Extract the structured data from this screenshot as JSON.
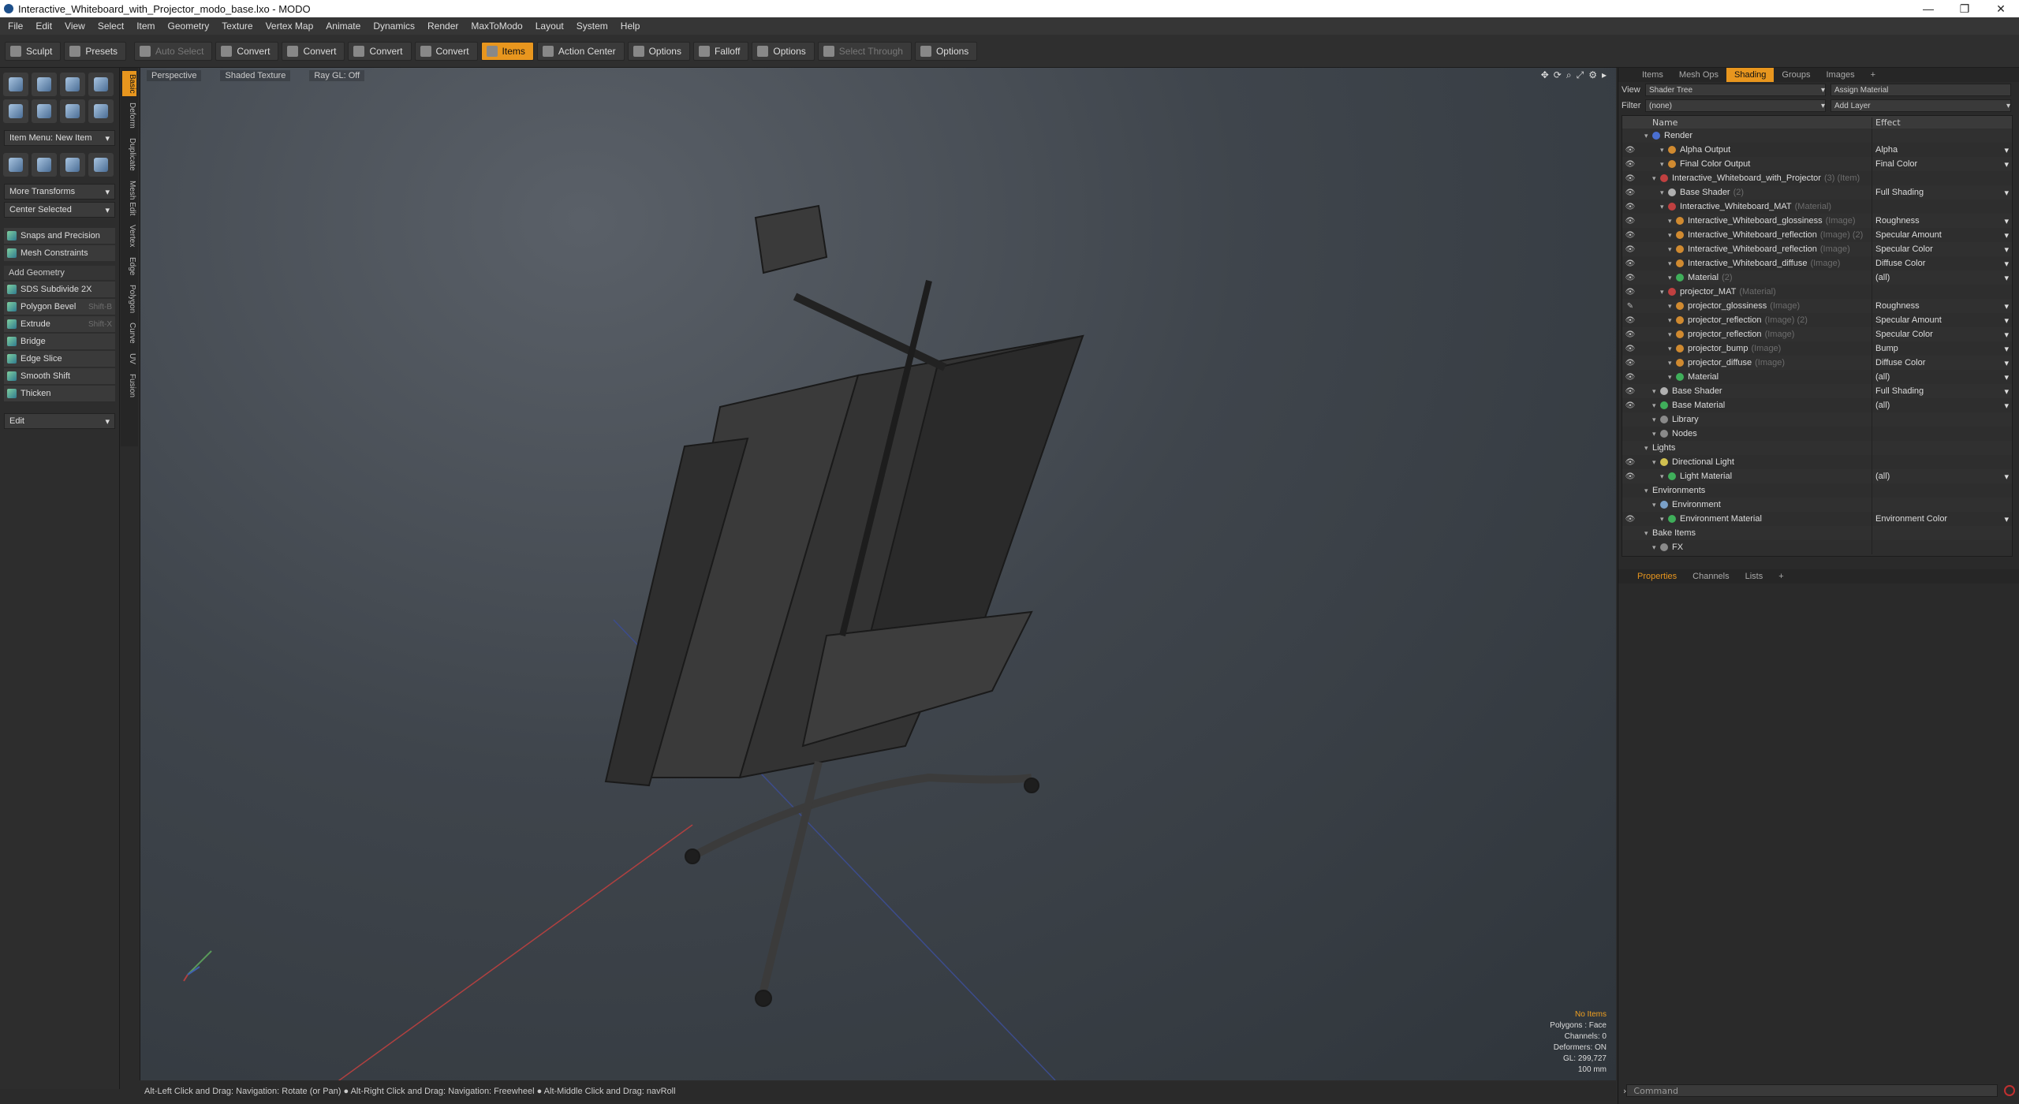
{
  "title": "Interactive_Whiteboard_with_Projector_modo_base.lxo - MODO",
  "window_controls": [
    "—",
    "❐",
    "✕"
  ],
  "menu": [
    "File",
    "Edit",
    "View",
    "Select",
    "Item",
    "Geometry",
    "Texture",
    "Vertex Map",
    "Animate",
    "Dynamics",
    "Render",
    "MaxToModo",
    "Layout",
    "System",
    "Help"
  ],
  "toolbar": {
    "sculpt": "Sculpt",
    "presets": "Presets",
    "auto_select": "Auto Select",
    "convert1": "Convert",
    "convert2": "Convert",
    "convert3": "Convert",
    "convert4": "Convert",
    "items": "Items",
    "action_center": "Action Center",
    "options1": "Options",
    "falloff": "Falloff",
    "options2": "Options",
    "select_through": "Select Through",
    "options3": "Options"
  },
  "left": {
    "item_menu": "Item Menu: New Item",
    "more_transforms": "More Transforms",
    "center_selected": "Center Selected",
    "snaps": "Snaps and Precision",
    "mesh_constraints": "Mesh Constraints",
    "add_geometry": "Add Geometry",
    "tools": [
      {
        "label": "SDS Subdivide 2X",
        "shortcut": ""
      },
      {
        "label": "Polygon Bevel",
        "shortcut": "Shift-B"
      },
      {
        "label": "Extrude",
        "shortcut": "Shift-X"
      },
      {
        "label": "Bridge",
        "shortcut": ""
      },
      {
        "label": "Edge Slice",
        "shortcut": ""
      },
      {
        "label": "Smooth Shift",
        "shortcut": ""
      },
      {
        "label": "Thicken",
        "shortcut": ""
      }
    ],
    "edit": "Edit",
    "vtabs": [
      "Basic",
      "Deform",
      "Duplicate",
      "Mesh Edit",
      "Vertex",
      "Edge",
      "Polygon",
      "Curve",
      "UV",
      "Fusion"
    ]
  },
  "viewport": {
    "perspective": "Perspective",
    "shaded": "Shaded Texture",
    "raygl": "Ray GL: Off",
    "info": {
      "no_items": "No Items",
      "polygons": "Polygons : Face",
      "channels": "Channels: 0",
      "deformers": "Deformers: ON",
      "gl": "GL: 299,727",
      "scale": "100 mm"
    }
  },
  "status": "Alt-Left Click and Drag: Navigation: Rotate (or Pan) ● Alt-Right Click and Drag: Navigation: Freewheel ● Alt-Middle Click and Drag: navRoll",
  "right": {
    "tabs": [
      "Items",
      "Mesh Ops",
      "Shading",
      "Groups",
      "Images",
      "+"
    ],
    "view_label": "View",
    "view_value": "Shader Tree",
    "assign": "Assign Material",
    "filter_label": "Filter",
    "filter_value": "(none)",
    "add_layer": "Add Layer",
    "col_name": "Name",
    "col_effect": "Effect",
    "tree": [
      {
        "d": 0,
        "name": "Render",
        "tag": "",
        "effect": "",
        "c": "#4a6fd0",
        "eye": ""
      },
      {
        "d": 2,
        "name": "Alpha Output",
        "tag": "",
        "effect": "Alpha",
        "c": "#d08a30",
        "eye": "👁"
      },
      {
        "d": 2,
        "name": "Final Color Output",
        "tag": "",
        "effect": "Final Color",
        "c": "#d08a30",
        "eye": "👁"
      },
      {
        "d": 1,
        "name": "Interactive_Whiteboard_with_Projector",
        "tag": "(3) (Item)",
        "effect": "",
        "c": "#c04040",
        "eye": "👁"
      },
      {
        "d": 2,
        "name": "Base Shader",
        "tag": "(2)",
        "effect": "Full Shading",
        "c": "#b0b0b0",
        "eye": "👁"
      },
      {
        "d": 2,
        "name": "Interactive_Whiteboard_MAT",
        "tag": "(Material)",
        "effect": "",
        "c": "#c04040",
        "eye": "👁"
      },
      {
        "d": 3,
        "name": "Interactive_Whiteboard_glossiness",
        "tag": "(Image)",
        "effect": "Roughness",
        "c": "#d08a30",
        "eye": "👁"
      },
      {
        "d": 3,
        "name": "Interactive_Whiteboard_reflection",
        "tag": "(Image) (2)",
        "effect": "Specular Amount",
        "c": "#d08a30",
        "eye": "👁"
      },
      {
        "d": 3,
        "name": "Interactive_Whiteboard_reflection",
        "tag": "(Image)",
        "effect": "Specular Color",
        "c": "#d08a30",
        "eye": "👁"
      },
      {
        "d": 3,
        "name": "Interactive_Whiteboard_diffuse",
        "tag": "(Image)",
        "effect": "Diffuse Color",
        "c": "#d08a30",
        "eye": "👁"
      },
      {
        "d": 3,
        "name": "Material",
        "tag": "(2)",
        "effect": "(all)",
        "c": "#3fae5a",
        "eye": "👁"
      },
      {
        "d": 2,
        "name": "projector_MAT",
        "tag": "(Material)",
        "effect": "",
        "c": "#c04040",
        "eye": "👁"
      },
      {
        "d": 3,
        "name": "projector_glossiness",
        "tag": "(Image)",
        "effect": "Roughness",
        "c": "#d08a30",
        "eye": "✎"
      },
      {
        "d": 3,
        "name": "projector_reflection",
        "tag": "(Image) (2)",
        "effect": "Specular Amount",
        "c": "#d08a30",
        "eye": "👁"
      },
      {
        "d": 3,
        "name": "projector_reflection",
        "tag": "(Image)",
        "effect": "Specular Color",
        "c": "#d08a30",
        "eye": "👁"
      },
      {
        "d": 3,
        "name": "projector_bump",
        "tag": "(Image)",
        "effect": "Bump",
        "c": "#d08a30",
        "eye": "👁"
      },
      {
        "d": 3,
        "name": "projector_diffuse",
        "tag": "(Image)",
        "effect": "Diffuse Color",
        "c": "#d08a30",
        "eye": "👁"
      },
      {
        "d": 3,
        "name": "Material",
        "tag": "",
        "effect": "(all)",
        "c": "#3fae5a",
        "eye": "👁"
      },
      {
        "d": 1,
        "name": "Base Shader",
        "tag": "",
        "effect": "Full Shading",
        "c": "#b0b0b0",
        "eye": "👁"
      },
      {
        "d": 1,
        "name": "Base Material",
        "tag": "",
        "effect": "(all)",
        "c": "#3fae5a",
        "eye": "👁"
      },
      {
        "d": 1,
        "name": "Library",
        "tag": "",
        "effect": "",
        "c": "#8a8a8a",
        "eye": ""
      },
      {
        "d": 1,
        "name": "Nodes",
        "tag": "",
        "effect": "",
        "c": "#8a8a8a",
        "eye": ""
      },
      {
        "d": 0,
        "name": "Lights",
        "tag": "",
        "effect": "",
        "c": "",
        "eye": ""
      },
      {
        "d": 1,
        "name": "Directional Light",
        "tag": "",
        "effect": "",
        "c": "#d0c050",
        "eye": "👁"
      },
      {
        "d": 2,
        "name": "Light Material",
        "tag": "",
        "effect": "(all)",
        "c": "#3fae5a",
        "eye": "👁"
      },
      {
        "d": 0,
        "name": "Environments",
        "tag": "",
        "effect": "",
        "c": "",
        "eye": ""
      },
      {
        "d": 1,
        "name": "Environment",
        "tag": "",
        "effect": "",
        "c": "#7aa0c8",
        "eye": ""
      },
      {
        "d": 2,
        "name": "Environment Material",
        "tag": "",
        "effect": "Environment Color",
        "c": "#3fae5a",
        "eye": "👁"
      },
      {
        "d": 0,
        "name": "Bake Items",
        "tag": "",
        "effect": "",
        "c": "",
        "eye": ""
      },
      {
        "d": 1,
        "name": "FX",
        "tag": "",
        "effect": "",
        "c": "#8a8a8a",
        "eye": ""
      }
    ],
    "props_tabs": [
      "Properties",
      "Channels",
      "Lists",
      "+"
    ],
    "command": "Command"
  }
}
